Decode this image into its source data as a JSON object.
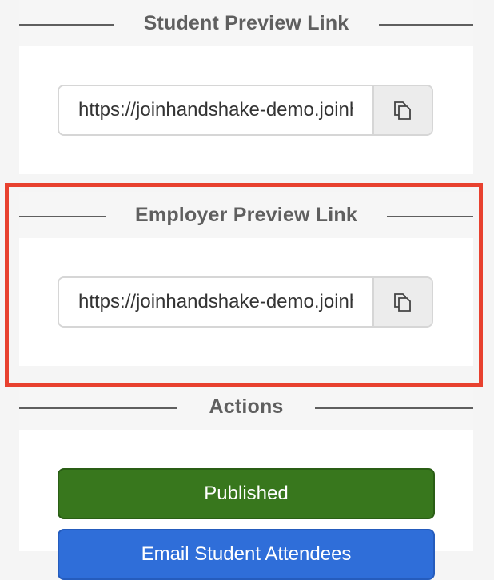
{
  "student_preview": {
    "title": "Student Preview Link",
    "url": "https://joinhandshake-demo.joinhandshake.com/stu/events/preview",
    "copy_icon": "copy-icon"
  },
  "employer_preview": {
    "title": "Employer Preview Link",
    "url": "https://joinhandshake-demo.joinhandshake.com/emp/events/preview",
    "copy_icon": "copy-icon"
  },
  "actions": {
    "title": "Actions",
    "published_label": "Published",
    "email_label": "Email Student Attendees"
  },
  "colors": {
    "published": "#38771d",
    "email": "#2f6ed9",
    "highlight": "#e8412f"
  }
}
